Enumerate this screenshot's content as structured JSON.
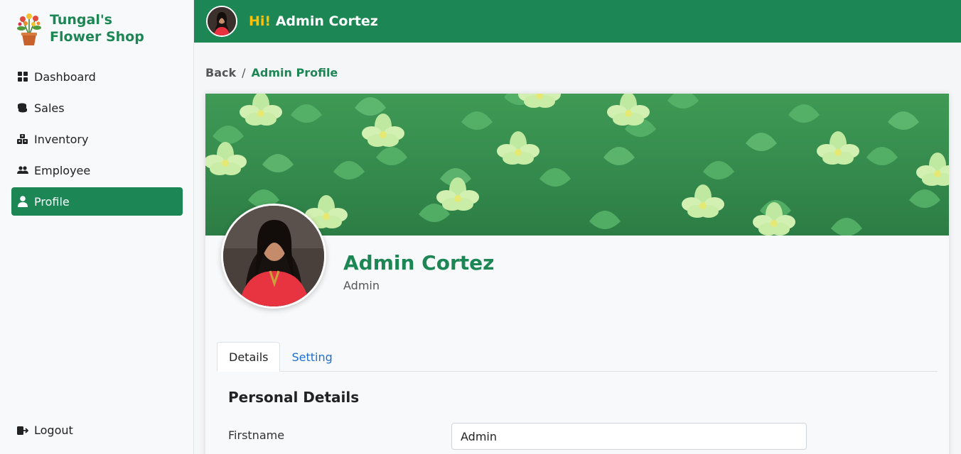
{
  "brand": {
    "line1": "Tungal's",
    "line2": "Flower Shop"
  },
  "sidebar": {
    "items": [
      {
        "label": "Dashboard",
        "icon": "grid-icon"
      },
      {
        "label": "Sales",
        "icon": "coins-icon"
      },
      {
        "label": "Inventory",
        "icon": "boxes-icon"
      },
      {
        "label": "Employee",
        "icon": "users-icon"
      },
      {
        "label": "Profile",
        "icon": "user-icon",
        "active": true
      }
    ],
    "logout_label": "Logout"
  },
  "header": {
    "hi": "Hi!",
    "name": "Admin Cortez"
  },
  "breadcrumb": {
    "back": "Back",
    "separator": "/",
    "current": "Admin Profile"
  },
  "profile": {
    "name": "Admin Cortez",
    "role": "Admin"
  },
  "tabs": [
    {
      "label": "Details",
      "active": true
    },
    {
      "label": "Setting"
    }
  ],
  "details": {
    "section_title": "Personal Details",
    "firstname_label": "Firstname",
    "firstname_value": "Admin"
  },
  "colors": {
    "primary": "#1c8754",
    "accent": "#ffc107",
    "link": "#1f6fd1"
  }
}
